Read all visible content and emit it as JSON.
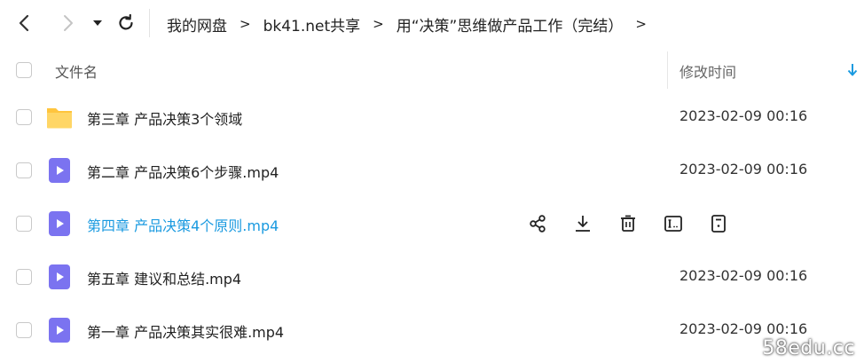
{
  "nav": {
    "back_icon": "chevron-left-icon",
    "forward_icon": "chevron-right-icon",
    "history_dropdown_icon": "caret-down-icon",
    "refresh_icon": "refresh-icon",
    "breadcrumb": [
      "我的网盘",
      "bk41.net共享",
      "用“决策”思维做产品工作（完结）"
    ],
    "breadcrumb_separator": ">",
    "trailing_separator": ">"
  },
  "list_header": {
    "name_label": "文件名",
    "time_label": "修改时间",
    "sort_icon": "sort-down-arrow-icon"
  },
  "rows": [
    {
      "name": "第三章 产品决策3个领域",
      "time": "2023-02-09 00:16",
      "type": "folder"
    },
    {
      "name": "第二章 产品决策6个步骤.mp4",
      "time": "2023-02-09 00:16",
      "type": "video"
    },
    {
      "name": "第四章 产品决策4个原则.mp4",
      "time": "",
      "type": "video",
      "hover": true
    },
    {
      "name": "第五章 建议和总结.mp4",
      "time": "2023-02-09 00:16",
      "type": "video"
    },
    {
      "name": "第一章 产品决策其实很难.mp4",
      "time": "2023-02-09 00:16",
      "type": "video"
    }
  ],
  "hover_actions": [
    "share-icon",
    "download-icon",
    "delete-icon",
    "rename-icon",
    "more-icon"
  ],
  "colors": {
    "accent": "#1a9ae0",
    "folder": "#ffc53d",
    "video_icon": "#7b73f0"
  },
  "watermark": "58edu.cc"
}
